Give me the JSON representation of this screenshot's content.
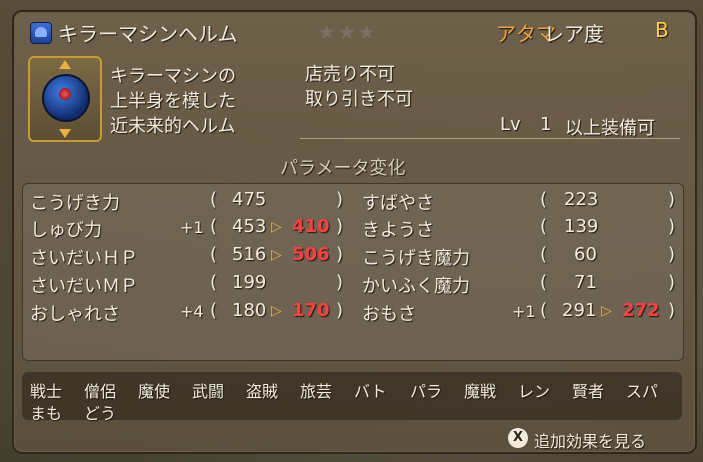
{
  "item": {
    "name": "キラーマシンヘルム",
    "category": "アタマ",
    "rarity_label": "レア度",
    "rarity_value": "B",
    "stars": "★★★",
    "description_lines": [
      "キラーマシンの",
      "上半身を模した",
      "近未来的ヘルム"
    ],
    "restrictions": [
      "店売り不可",
      "取り引き不可"
    ],
    "level_requirement": {
      "prefix": "Lv",
      "value": "1",
      "suffix": "以上装備可"
    }
  },
  "params": {
    "heading": "パラメータ変化",
    "left": [
      {
        "name": "こうげき力",
        "bonus": "",
        "base": "475",
        "new": ""
      },
      {
        "name": "しゅび力",
        "bonus": "+1",
        "base": "453",
        "new": "410"
      },
      {
        "name": "さいだいＨＰ",
        "bonus": "",
        "base": "516",
        "new": "506"
      },
      {
        "name": "さいだいＭＰ",
        "bonus": "",
        "base": "199",
        "new": ""
      },
      {
        "name": "おしゃれさ",
        "bonus": "+4",
        "base": "180",
        "new": "170"
      }
    ],
    "right": [
      {
        "name": "すばやさ",
        "bonus": "",
        "base": "223",
        "new": ""
      },
      {
        "name": "きようさ",
        "bonus": "",
        "base": "139",
        "new": ""
      },
      {
        "name": "こうげき魔力",
        "bonus": "",
        "base": "60",
        "new": ""
      },
      {
        "name": "かいふく魔力",
        "bonus": "",
        "base": "71",
        "new": ""
      },
      {
        "name": "おもさ",
        "bonus": "+1",
        "base": "291",
        "new": "272"
      }
    ]
  },
  "jobs": {
    "row1": [
      "戦士",
      "僧侶",
      "魔使",
      "武闘",
      "盗賊",
      "旅芸",
      "バト",
      "パラ",
      "魔戦",
      "レン",
      "賢者",
      "スパ"
    ],
    "row2": [
      "まも",
      "どう"
    ]
  },
  "footer": {
    "button_glyph": "X",
    "action_label": "追加効果を見る"
  },
  "colors": {
    "category": "#f0a040",
    "rarity": "#ffd23a",
    "decrease": "#ff4040",
    "arrow": "#e8b040"
  }
}
